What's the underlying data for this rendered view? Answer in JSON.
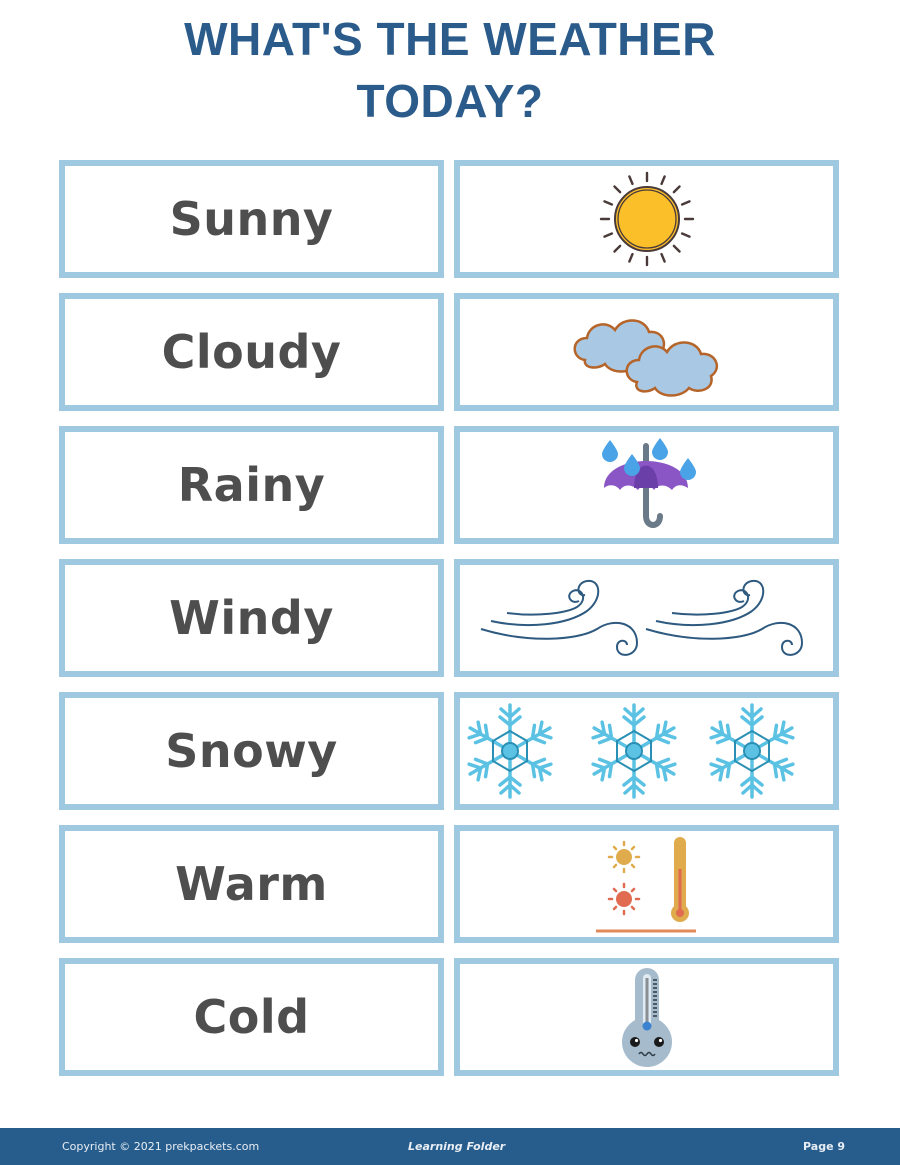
{
  "page": {
    "title_line1": "WHAT'S THE WEATHER",
    "title_line2": "TODAY?"
  },
  "rows": [
    {
      "label": "Sunny",
      "icon": "sun-icon"
    },
    {
      "label": "Cloudy",
      "icon": "clouds-icon"
    },
    {
      "label": "Rainy",
      "icon": "umbrella-rain-icon"
    },
    {
      "label": "Windy",
      "icon": "wind-icon"
    },
    {
      "label": "Snowy",
      "icon": "snowflake-icon"
    },
    {
      "label": "Warm",
      "icon": "warm-thermometer-icon"
    },
    {
      "label": "Cold",
      "icon": "cold-thermometer-icon"
    }
  ],
  "colors": {
    "title": "#2a5b8a",
    "card_border": "#9fc9e1",
    "word": "#4e4e4e",
    "footer_bg": "#275d8c"
  },
  "footer": {
    "copyright": "Copyright © 2021 prekpackets.com",
    "center": "Learning Folder",
    "page": "Page 9"
  }
}
